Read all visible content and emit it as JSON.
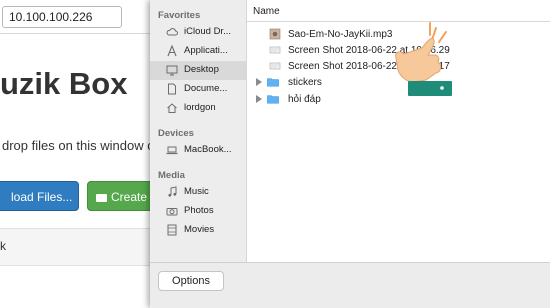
{
  "browser": {
    "address_value": "10.100.100.226"
  },
  "page": {
    "title": "uzik Box",
    "hint": "drop files on this window or",
    "upload_label": "load Files...",
    "create_label": "Create",
    "panel_text": "k"
  },
  "dialog": {
    "sidebar": {
      "favorites_label": "Favorites",
      "favorites": [
        {
          "label": "iCloud Dr...",
          "icon": "cloud-icon"
        },
        {
          "label": "Applicati...",
          "icon": "applications-icon"
        },
        {
          "label": "Desktop",
          "icon": "desktop-icon",
          "selected": true
        },
        {
          "label": "Docume...",
          "icon": "documents-icon"
        },
        {
          "label": "lordgon",
          "icon": "home-icon"
        }
      ],
      "devices_label": "Devices",
      "devices": [
        {
          "label": "MacBook...",
          "icon": "laptop-icon"
        }
      ],
      "media_label": "Media",
      "media": [
        {
          "label": "Music",
          "icon": "music-icon"
        },
        {
          "label": "Photos",
          "icon": "camera-icon"
        },
        {
          "label": "Movies",
          "icon": "film-icon"
        }
      ]
    },
    "files": {
      "column_name": "Name",
      "rows": [
        {
          "name": "Sao-Em-No-JayKii.mp3",
          "icon": "audio-file-icon"
        },
        {
          "name": "Screen Shot 2018-06-22 at 10.36.29",
          "icon": "image-file-icon"
        },
        {
          "name": "Screen Shot 2018-06-22 at 10.39.17",
          "icon": "image-file-icon"
        },
        {
          "name": "stickers",
          "icon": "folder-icon"
        },
        {
          "name": "hỏi đáp",
          "icon": "folder-icon"
        }
      ]
    },
    "options_label": "Options"
  },
  "colors": {
    "upload_button": "#2f7cc0",
    "create_button": "#55a94c",
    "folder_blue": "#5fb3f2",
    "sidebar_bg": "#eeedee",
    "hand_cuff": "#1e8c78"
  }
}
